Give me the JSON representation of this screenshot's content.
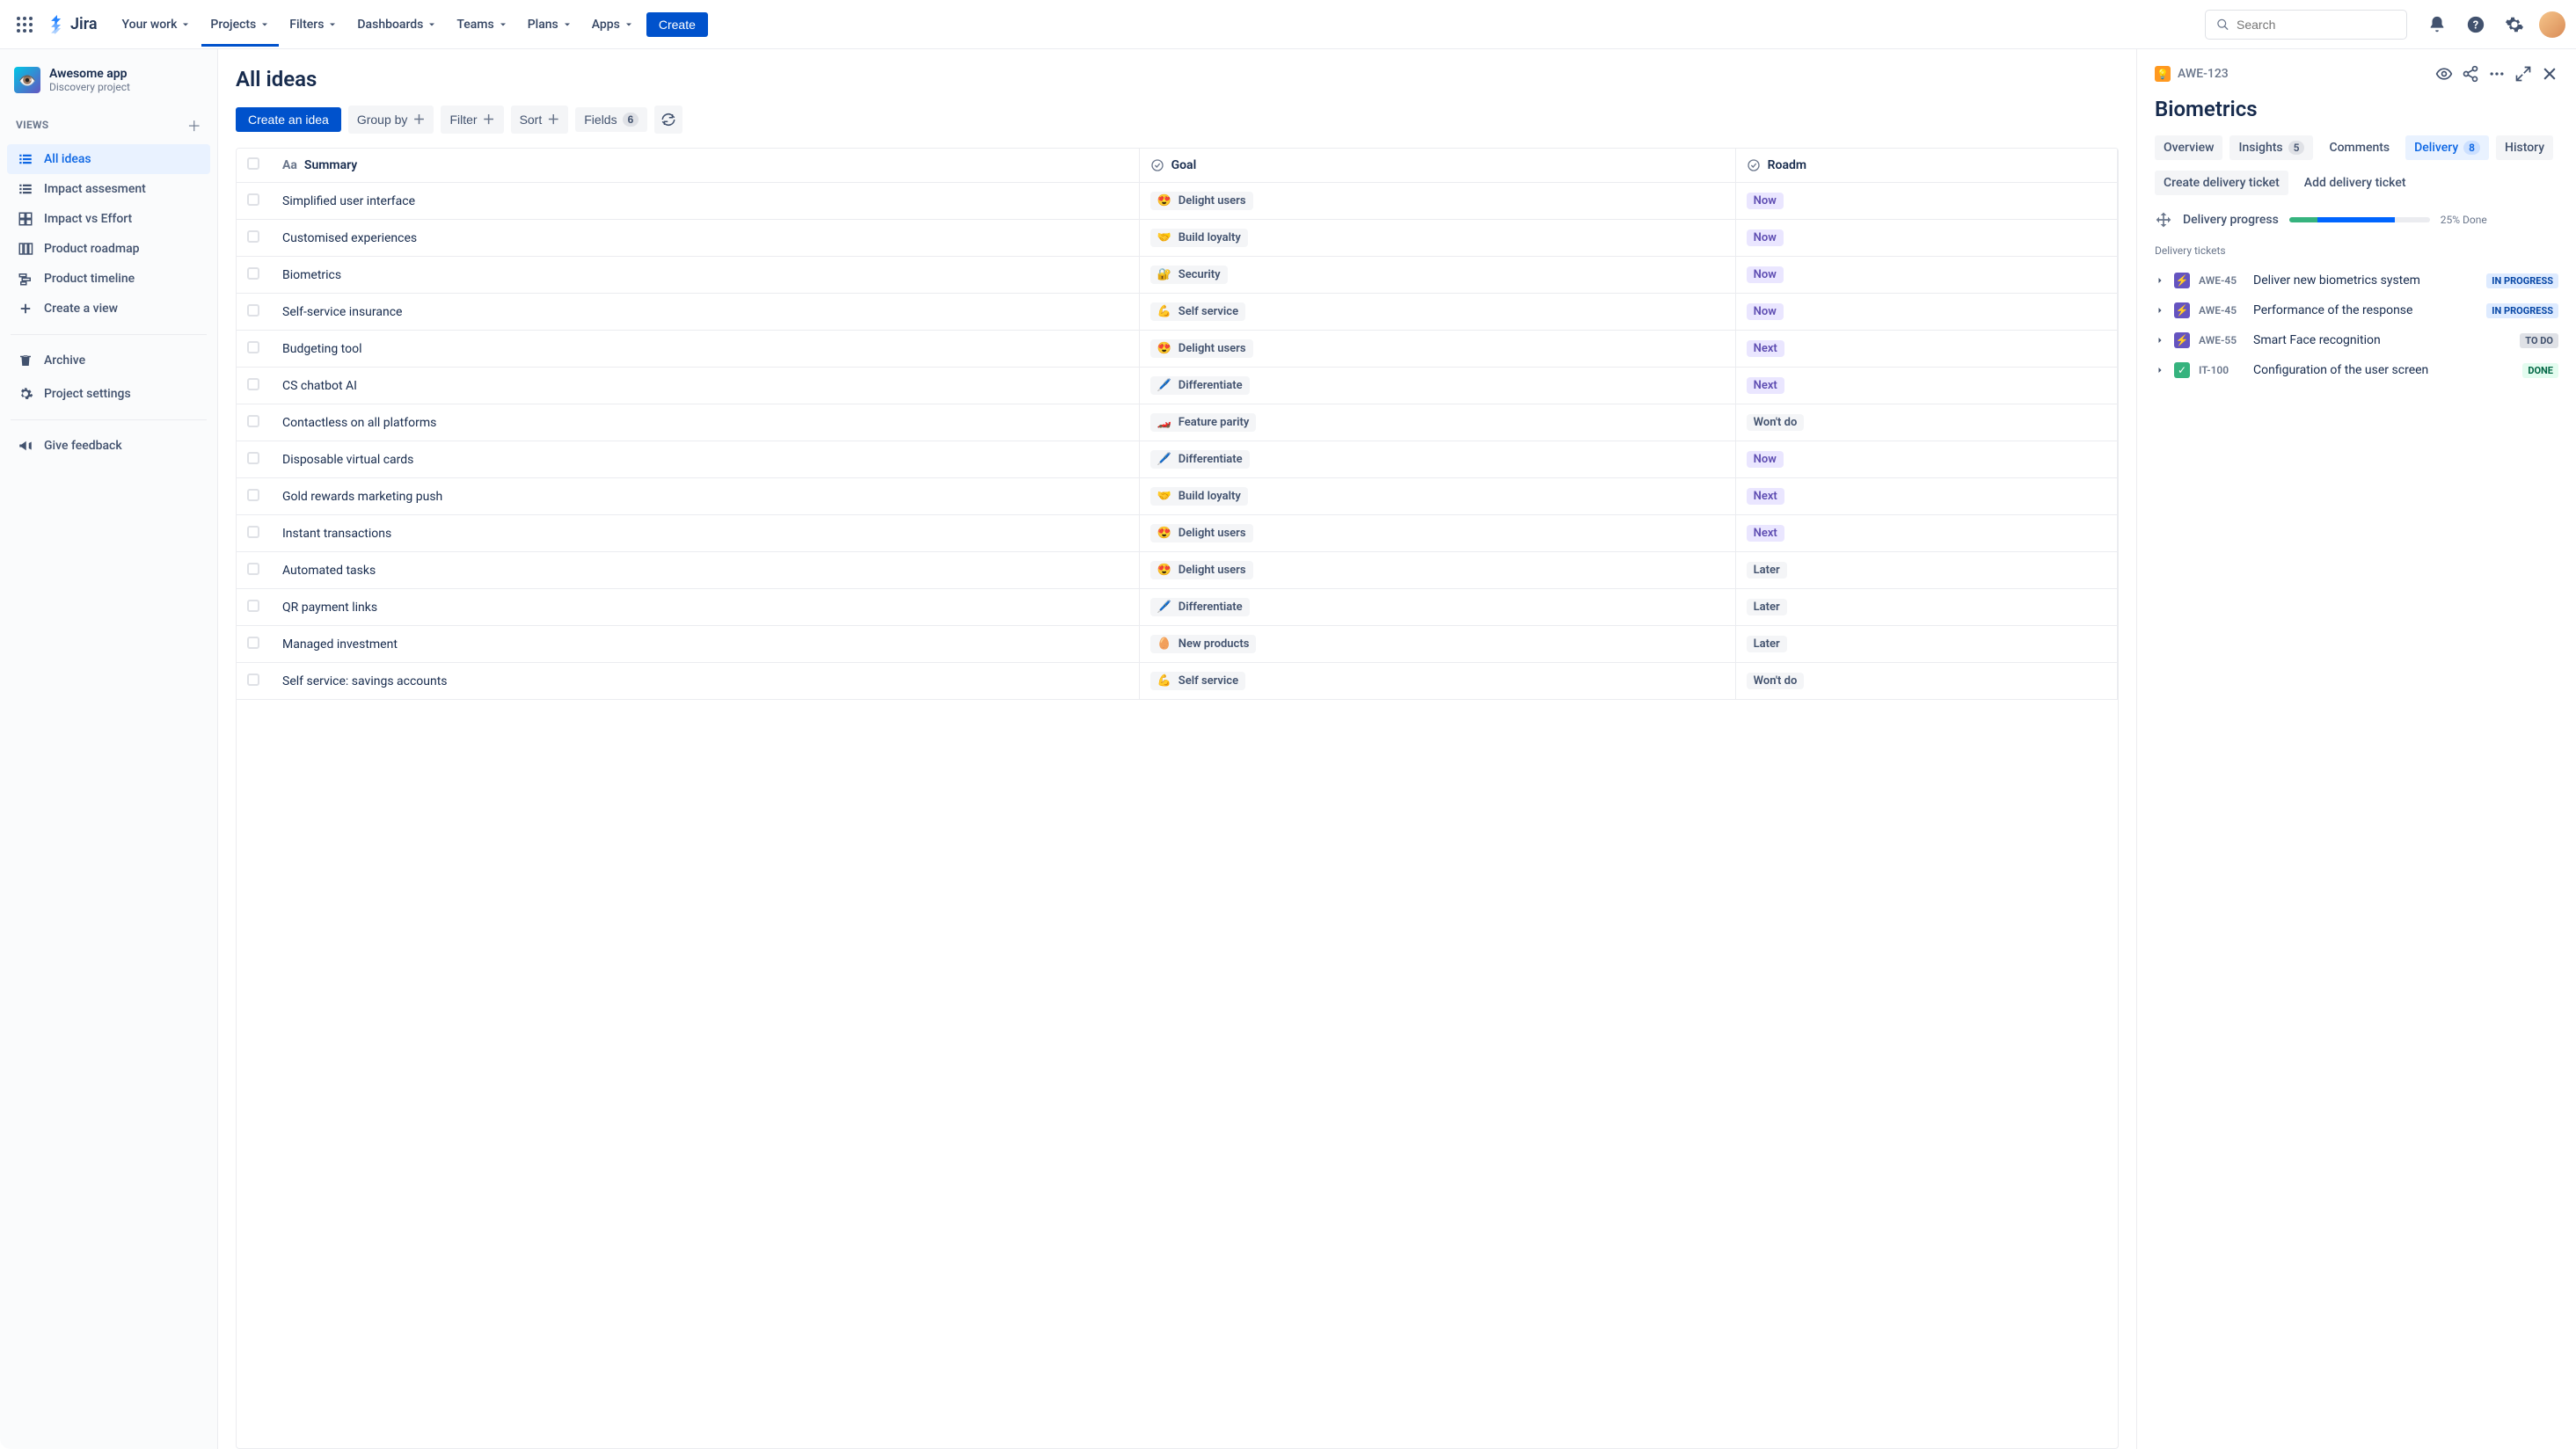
{
  "nav": {
    "product": "Jira",
    "items": [
      "Your work",
      "Projects",
      "Filters",
      "Dashboards",
      "Teams",
      "Plans",
      "Apps"
    ],
    "create": "Create",
    "search_placeholder": "Search"
  },
  "sidebar": {
    "project_name": "Awesome app",
    "project_sub": "Discovery project",
    "views_label": "VIEWS",
    "items": [
      {
        "label": "All ideas",
        "icon": "list",
        "active": true
      },
      {
        "label": "Impact assesment",
        "icon": "list"
      },
      {
        "label": "Impact vs Effort",
        "icon": "matrix"
      },
      {
        "label": "Product roadmap",
        "icon": "board"
      },
      {
        "label": "Product timeline",
        "icon": "timeline"
      },
      {
        "label": "Create a view",
        "icon": "plus"
      }
    ],
    "archive": "Archive",
    "settings": "Project settings",
    "feedback": "Give feedback"
  },
  "page": {
    "title": "All ideas",
    "create_idea": "Create an idea",
    "group_by": "Group by",
    "filter": "Filter",
    "sort": "Sort",
    "fields": "Fields",
    "fields_count": "6"
  },
  "columns": {
    "summary": "Summary",
    "goal": "Goal",
    "roadmap": "Roadm"
  },
  "goals": {
    "delight": {
      "emoji": "😍",
      "label": "Delight users"
    },
    "loyalty": {
      "emoji": "🤝",
      "label": "Build loyalty"
    },
    "security": {
      "emoji": "🔐",
      "label": "Security"
    },
    "self": {
      "emoji": "💪",
      "label": "Self service"
    },
    "diff": {
      "emoji": "🖊️",
      "label": "Differentiate"
    },
    "parity": {
      "emoji": "🏎️",
      "label": "Feature parity"
    },
    "new": {
      "emoji": "🥚",
      "label": "New products"
    }
  },
  "roadmap_labels": {
    "now": "Now",
    "next": "Next",
    "later": "Later",
    "wont": "Won't do"
  },
  "rows": [
    {
      "summary": "Simplified user interface",
      "goal": "delight",
      "roadmap": "now"
    },
    {
      "summary": "Customised experiences",
      "goal": "loyalty",
      "roadmap": "now"
    },
    {
      "summary": "Biometrics",
      "goal": "security",
      "roadmap": "now"
    },
    {
      "summary": "Self-service insurance",
      "goal": "self",
      "roadmap": "now"
    },
    {
      "summary": "Budgeting tool",
      "goal": "delight",
      "roadmap": "next"
    },
    {
      "summary": "CS chatbot AI",
      "goal": "diff",
      "roadmap": "next"
    },
    {
      "summary": "Contactless on all platforms",
      "goal": "parity",
      "roadmap": "wont"
    },
    {
      "summary": "Disposable virtual cards",
      "goal": "diff",
      "roadmap": "now"
    },
    {
      "summary": "Gold rewards marketing push",
      "goal": "loyalty",
      "roadmap": "next"
    },
    {
      "summary": "Instant transactions",
      "goal": "delight",
      "roadmap": "next"
    },
    {
      "summary": "Automated tasks",
      "goal": "delight",
      "roadmap": "later"
    },
    {
      "summary": "QR payment links",
      "goal": "diff",
      "roadmap": "later"
    },
    {
      "summary": "Managed investment",
      "goal": "new",
      "roadmap": "later"
    },
    {
      "summary": "Self service: savings accounts",
      "goal": "self",
      "roadmap": "wont"
    }
  ],
  "detail": {
    "key": "AWE-123",
    "title": "Biometrics",
    "tabs": {
      "overview": "Overview",
      "insights": "Insights",
      "insights_count": "5",
      "comments": "Comments",
      "delivery": "Delivery",
      "delivery_count": "8",
      "history": "History"
    },
    "actions": {
      "create": "Create delivery ticket",
      "add": "Add delivery ticket"
    },
    "progress": {
      "label": "Delivery progress",
      "pct_text": "25% Done",
      "green": 20,
      "blue": 55
    },
    "tickets_label": "Delivery tickets",
    "tickets": [
      {
        "key": "AWE-45",
        "title": "Deliver new biometrics system",
        "status": "IN PROGRESS",
        "status_cls": "progress",
        "icon": "purple"
      },
      {
        "key": "AWE-45",
        "title": "Performance of the response",
        "status": "IN PROGRESS",
        "status_cls": "progress",
        "icon": "purple"
      },
      {
        "key": "AWE-55",
        "title": "Smart Face recognition",
        "status": "TO DO",
        "status_cls": "todo",
        "icon": "purple"
      },
      {
        "key": "IT-100",
        "title": "Configuration of the user screen",
        "status": "DONE",
        "status_cls": "done",
        "icon": "green"
      }
    ]
  }
}
